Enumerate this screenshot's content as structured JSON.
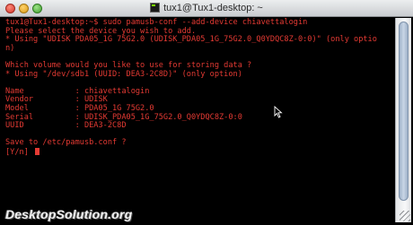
{
  "window": {
    "title": "tux1@Tux1-desktop: ~"
  },
  "terminal": {
    "lines": [
      "tux1@Tux1-desktop:~$ sudo pamusb-conf --add-device chiavettalogin",
      "Please select the device you wish to add.",
      "* Using \"UDISK PDA05_1G 75G2.0 (UDISK_PDA05_1G_75G2.0_Q0YDQC8Z-0:0)\" (only optio",
      "n)",
      "",
      "Which volume would you like to use for storing data ?",
      "* Using \"/dev/sdb1 (UUID: DEA3-2C8D)\" (only option)",
      "",
      "Name           : chiavettalogin",
      "Vendor         : UDISK",
      "Model          : PDA05_1G 75G2.0",
      "Serial         : UDISK_PDA05_1G_75G2.0_Q0YDQC8Z-0:0",
      "UUID           : DEA3-2C8D",
      "",
      "Save to /etc/pamusb.conf ?",
      "[Y/n] "
    ]
  },
  "watermark": {
    "text": "DesktopSolution.org"
  },
  "colors": {
    "terminal_text": "#e43a33",
    "terminal_background": "#000000"
  },
  "icons": {
    "title_icon": "terminal-icon",
    "close": "close-button-icon",
    "minimize": "minimize-button-icon",
    "zoom": "zoom-button-icon"
  }
}
